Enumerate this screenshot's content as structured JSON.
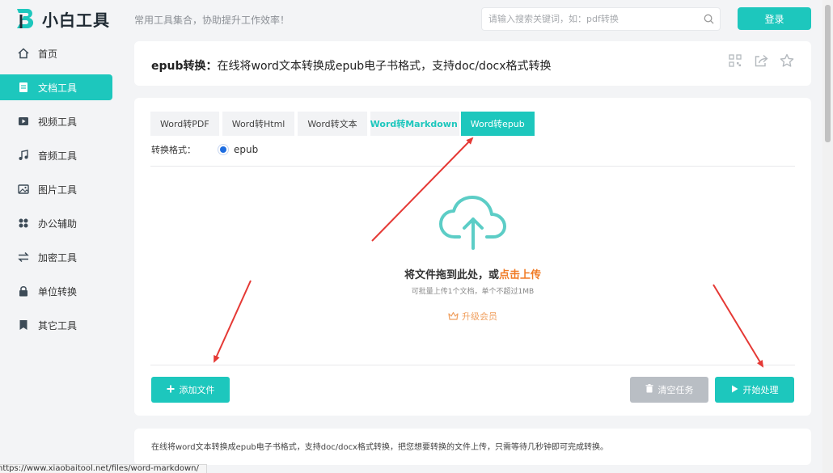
{
  "header": {
    "logo_text": "小白工具",
    "slogan": "常用工具集合，协助提升工作效率！",
    "search_placeholder": "请输入搜索关键词，如：pdf转换",
    "login_label": "登录"
  },
  "sidebar": {
    "items": [
      {
        "label": "首页",
        "icon": "home-icon"
      },
      {
        "label": "文档工具",
        "icon": "document-icon",
        "active": true
      },
      {
        "label": "视频工具",
        "icon": "video-icon"
      },
      {
        "label": "音频工具",
        "icon": "music-icon"
      },
      {
        "label": "图片工具",
        "icon": "image-icon"
      },
      {
        "label": "办公辅助",
        "icon": "grid-icon"
      },
      {
        "label": "加密工具",
        "icon": "swap-icon"
      },
      {
        "label": "单位转换",
        "icon": "lock-icon"
      },
      {
        "label": "其它工具",
        "icon": "bookmark-icon"
      }
    ]
  },
  "title_card": {
    "title_bold": "epub转换：",
    "title_rest": "在线将word文本转换成epub电子书格式，支持doc/docx格式转换"
  },
  "tabs": [
    {
      "label": "Word转PDF"
    },
    {
      "label": "Word转Html"
    },
    {
      "label": "Word转文本"
    },
    {
      "label": "Word转Markdown"
    },
    {
      "label": "Word转epub"
    }
  ],
  "format": {
    "label": "转换格式：",
    "option": "epub"
  },
  "upload": {
    "title_prefix": "将文件拖到此处，或",
    "title_link": "点击上传",
    "subtitle": "可批量上传1个文档，单个不超过1MB",
    "upgrade": "升级会员"
  },
  "buttons": {
    "add_file": "添加文件",
    "clear_tasks": "清空任务",
    "start": "开始处理"
  },
  "description": "在线将word文本转换成epub电子书格式，支持doc/docx格式转换，把您想要转换的文件上传，只需等待几秒钟即可完成转换。",
  "status_url": "https://www.xiaobaitool.net/files/word-markdown/",
  "colors": {
    "accent": "#1dc7bd",
    "highlight": "#f07b26",
    "annotation": "#e53935"
  }
}
